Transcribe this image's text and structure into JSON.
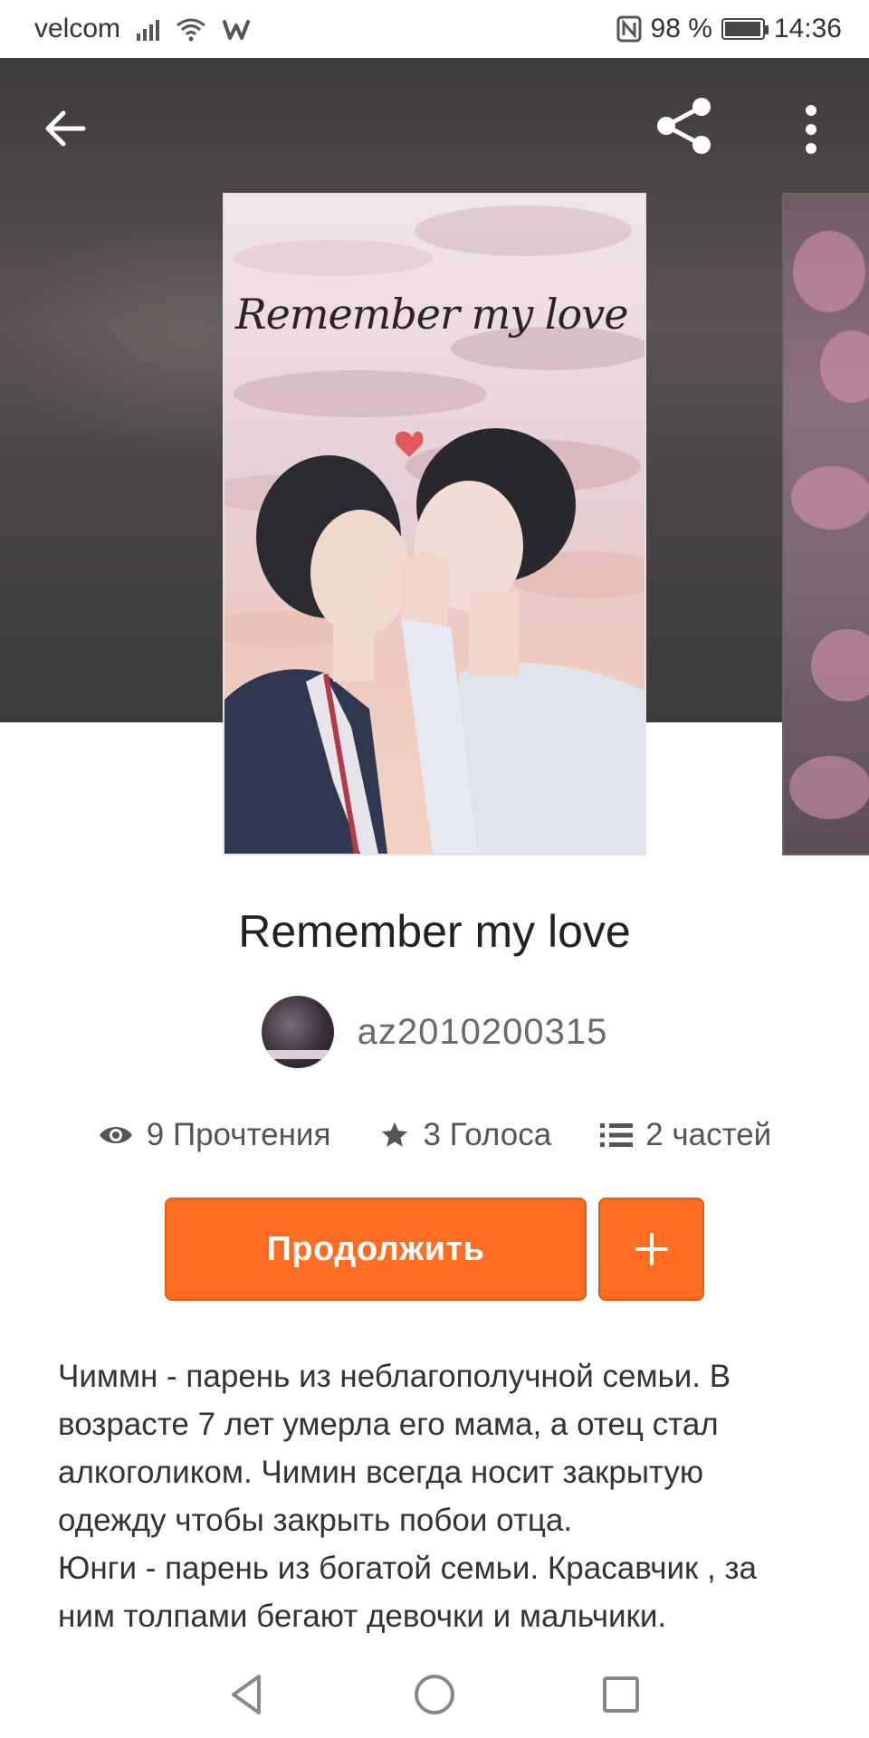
{
  "status_bar": {
    "carrier": "velcom",
    "battery_percent": "98 %",
    "battery_level": 0.98,
    "time": "14:36"
  },
  "top_bar": {
    "back_icon": "back-arrow-icon",
    "share_icon": "share-icon",
    "more_icon": "more-vert-icon"
  },
  "cover": {
    "title": "Remember my love"
  },
  "story": {
    "title": "Remember my love",
    "author": "az2010200315"
  },
  "stats": [
    {
      "icon": "eye-icon",
      "label": "9 Прочтения"
    },
    {
      "icon": "star-icon",
      "label": "3 Голоса"
    },
    {
      "icon": "list-icon",
      "label": "2 частей"
    }
  ],
  "actions": {
    "continue_label": "Продолжить",
    "add_icon": "plus-icon"
  },
  "description": "Чиммн - парень из неблагополучной семьи. В возрасте 7 лет умерла его мама, а отец стал алкоголиком. Чимин всегда носит закрытую одежду чтобы закрыть побои отца.\nЮнги - парень из богатой семьи. Красавчик , за ним толпами бегают девочки и мальчики.",
  "nav_bar": {
    "back_icon": "nav-back-icon",
    "home_icon": "nav-home-icon",
    "recents_icon": "nav-recents-icon"
  },
  "colors": {
    "accent": "#ff6d22",
    "hero_bg": "#4a4647"
  }
}
